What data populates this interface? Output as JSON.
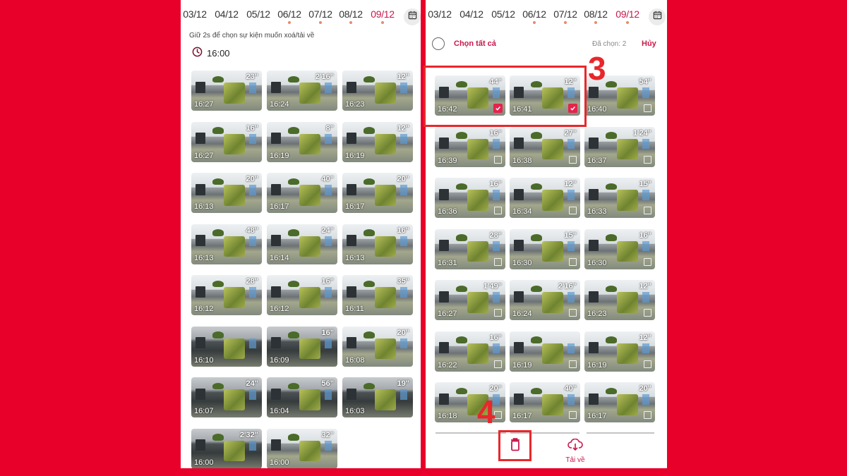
{
  "left_panel": {
    "dates": [
      {
        "label": "03/12",
        "active": false,
        "has_events": false
      },
      {
        "label": "04/12",
        "active": false,
        "has_events": false
      },
      {
        "label": "05/12",
        "active": false,
        "has_events": false
      },
      {
        "label": "06/12",
        "active": false,
        "has_events": true
      },
      {
        "label": "07/12",
        "active": false,
        "has_events": true
      },
      {
        "label": "08/12",
        "active": false,
        "has_events": true
      },
      {
        "label": "09/12",
        "active": true,
        "has_events": true
      }
    ],
    "calendar_icon": "calendar-icon",
    "hint": "Giữ 2s để chọn sự kiện muốn xoá/tải về",
    "time_header": "16:00",
    "clock_icon": "clock-icon",
    "thumbnails": [
      {
        "duration": "23\"",
        "time": "16:27",
        "dark": false
      },
      {
        "duration": "2'16\"",
        "time": "16:24",
        "dark": false
      },
      {
        "duration": "12\"",
        "time": "16:23",
        "dark": false
      },
      {
        "duration": "16\"",
        "time": "16:27",
        "dark": false
      },
      {
        "duration": "8\"",
        "time": "16:19",
        "dark": false
      },
      {
        "duration": "12\"",
        "time": "16:19",
        "dark": false
      },
      {
        "duration": "20\"",
        "time": "16:13",
        "dark": false
      },
      {
        "duration": "40\"",
        "time": "16:17",
        "dark": false
      },
      {
        "duration": "20\"",
        "time": "16:17",
        "dark": false
      },
      {
        "duration": "48\"",
        "time": "16:13",
        "dark": false
      },
      {
        "duration": "24\"",
        "time": "16:14",
        "dark": false
      },
      {
        "duration": "16\"",
        "time": "16:13",
        "dark": false
      },
      {
        "duration": "28\"",
        "time": "16:12",
        "dark": false
      },
      {
        "duration": "16\"",
        "time": "16:12",
        "dark": false
      },
      {
        "duration": "35\"",
        "time": "16:11",
        "dark": false
      },
      {
        "duration": "",
        "time": "16:10",
        "dark": true
      },
      {
        "duration": "16\"",
        "time": "16:09",
        "dark": true
      },
      {
        "duration": "20\"",
        "time": "16:08",
        "dark": false
      },
      {
        "duration": "24\"",
        "time": "16:07",
        "dark": true
      },
      {
        "duration": "56\"",
        "time": "16:04",
        "dark": true
      },
      {
        "duration": "19\"",
        "time": "16:03",
        "dark": true
      },
      {
        "duration": "2'32\"",
        "time": "16:00",
        "dark": true
      },
      {
        "duration": "32\"",
        "time": "16:00",
        "dark": false
      }
    ]
  },
  "right_panel": {
    "dates": [
      {
        "label": "03/12",
        "active": false,
        "has_events": false
      },
      {
        "label": "04/12",
        "active": false,
        "has_events": false
      },
      {
        "label": "05/12",
        "active": false,
        "has_events": false
      },
      {
        "label": "06/12",
        "active": false,
        "has_events": true
      },
      {
        "label": "07/12",
        "active": false,
        "has_events": true
      },
      {
        "label": "08/12",
        "active": false,
        "has_events": true
      },
      {
        "label": "09/12",
        "active": true,
        "has_events": true
      }
    ],
    "calendar_icon": "calendar-icon",
    "select_all_label": "Chọn tất cả",
    "selected_count": "Đã chọn: 2",
    "cancel_label": "Hủy",
    "thumbnails": [
      {
        "duration": "44\"",
        "time": "16:42",
        "selected": true
      },
      {
        "duration": "12\"",
        "time": "16:41",
        "selected": true
      },
      {
        "duration": "54\"",
        "time": "16:40",
        "selected": false
      },
      {
        "duration": "16\"",
        "time": "16:39",
        "selected": false
      },
      {
        "duration": "27\"",
        "time": "16:38",
        "selected": false
      },
      {
        "duration": "1'24\"",
        "time": "16:37",
        "selected": false
      },
      {
        "duration": "16\"",
        "time": "16:36",
        "selected": false
      },
      {
        "duration": "12\"",
        "time": "16:34",
        "selected": false
      },
      {
        "duration": "15\"",
        "time": "16:33",
        "selected": false
      },
      {
        "duration": "28\"",
        "time": "16:31",
        "selected": false
      },
      {
        "duration": "15\"",
        "time": "16:30",
        "selected": false
      },
      {
        "duration": "16\"",
        "time": "16:30",
        "selected": false
      },
      {
        "duration": "1'49\"",
        "time": "16:27",
        "selected": false
      },
      {
        "duration": "2'16\"",
        "time": "16:24",
        "selected": false
      },
      {
        "duration": "12\"",
        "time": "16:23",
        "selected": false
      },
      {
        "duration": "16\"",
        "time": "16:22",
        "selected": false
      },
      {
        "duration": "",
        "time": "16:19",
        "selected": false
      },
      {
        "duration": "12\"",
        "time": "16:19",
        "selected": false
      },
      {
        "duration": "20\"",
        "time": "16:18",
        "selected": false
      },
      {
        "duration": "40\"",
        "time": "16:17",
        "selected": false
      },
      {
        "duration": "20\"",
        "time": "16:17",
        "selected": false
      }
    ],
    "delete_icon": "trash-icon",
    "download_icon": "cloud-download-icon",
    "download_label": "Tải về"
  },
  "annotations": [
    {
      "label": "3"
    },
    {
      "label": "4"
    }
  ],
  "colors": {
    "background": "#e8002a",
    "accent": "#c8174a",
    "checkbox": "#e5234c",
    "annotation": "#e8272b"
  }
}
